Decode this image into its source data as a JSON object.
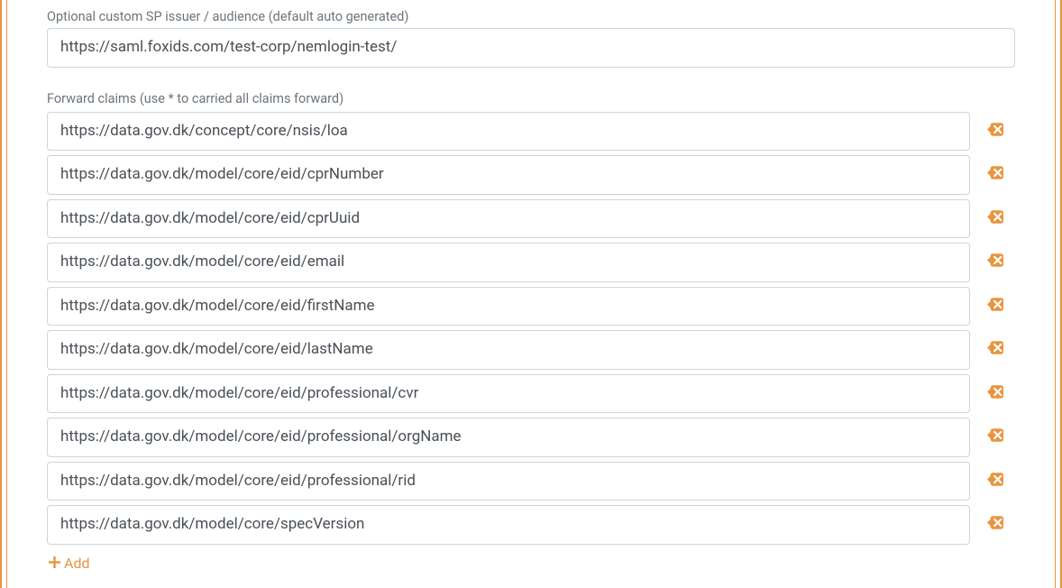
{
  "sp_issuer": {
    "label": "Optional custom SP issuer / audience (default auto generated)",
    "value": "https://saml.foxids.com/test-corp/nemlogin-test/"
  },
  "forward_claims": {
    "label": "Forward claims (use * to carried all claims forward)",
    "items": [
      "https://data.gov.dk/concept/core/nsis/loa",
      "https://data.gov.dk/model/core/eid/cprNumber",
      "https://data.gov.dk/model/core/eid/cprUuid",
      "https://data.gov.dk/model/core/eid/email",
      "https://data.gov.dk/model/core/eid/firstName",
      "https://data.gov.dk/model/core/eid/lastName",
      "https://data.gov.dk/model/core/eid/professional/cvr",
      "https://data.gov.dk/model/core/eid/professional/orgName",
      "https://data.gov.dk/model/core/eid/professional/rid",
      "https://data.gov.dk/model/core/specVersion"
    ],
    "add_label": "Add"
  },
  "colors": {
    "accent": "#e8953f"
  }
}
